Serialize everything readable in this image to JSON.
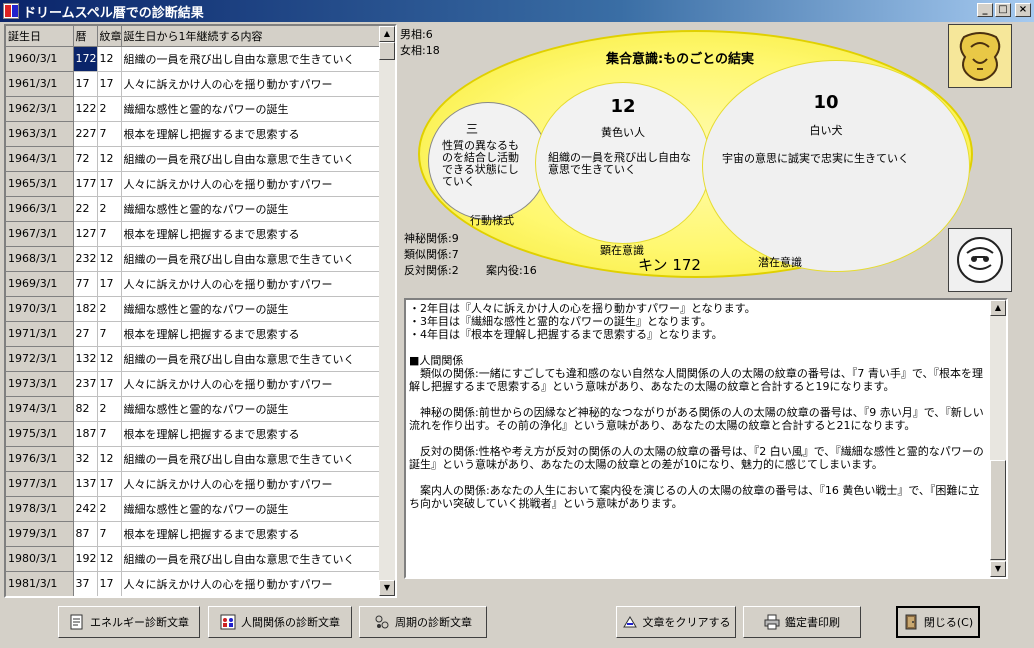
{
  "window": {
    "title": "ドリームスペル暦での診断結果",
    "min_glyph": "_",
    "max_glyph": "□",
    "close_glyph": "×"
  },
  "table": {
    "headers": [
      "誕生日",
      "暦",
      "紋章",
      "誕生日から1年継続する内容"
    ],
    "rows": [
      [
        "1960/3/1",
        "172",
        "12",
        "組織の一員を飛び出し自由な意思で生きていく"
      ],
      [
        "1961/3/1",
        "17",
        "17",
        "人々に訴えかけ人の心を揺り動かすパワー"
      ],
      [
        "1962/3/1",
        "122",
        "2",
        "繊細な感性と霊的なパワーの誕生"
      ],
      [
        "1963/3/1",
        "227",
        "7",
        "根本を理解し把握するまで思索する"
      ],
      [
        "1964/3/1",
        "72",
        "12",
        "組織の一員を飛び出し自由な意思で生きていく"
      ],
      [
        "1965/3/1",
        "177",
        "17",
        "人々に訴えかけ人の心を揺り動かすパワー"
      ],
      [
        "1966/3/1",
        "22",
        "2",
        "繊細な感性と霊的なパワーの誕生"
      ],
      [
        "1967/3/1",
        "127",
        "7",
        "根本を理解し把握するまで思索する"
      ],
      [
        "1968/3/1",
        "232",
        "12",
        "組織の一員を飛び出し自由な意思で生きていく"
      ],
      [
        "1969/3/1",
        "77",
        "17",
        "人々に訴えかけ人の心を揺り動かすパワー"
      ],
      [
        "1970/3/1",
        "182",
        "2",
        "繊細な感性と霊的なパワーの誕生"
      ],
      [
        "1971/3/1",
        "27",
        "7",
        "根本を理解し把握するまで思索する"
      ],
      [
        "1972/3/1",
        "132",
        "12",
        "組織の一員を飛び出し自由な意思で生きていく"
      ],
      [
        "1973/3/1",
        "237",
        "17",
        "人々に訴えかけ人の心を揺り動かすパワー"
      ],
      [
        "1974/3/1",
        "82",
        "2",
        "繊細な感性と霊的なパワーの誕生"
      ],
      [
        "1975/3/1",
        "187",
        "7",
        "根本を理解し把握するまで思索する"
      ],
      [
        "1976/3/1",
        "32",
        "12",
        "組織の一員を飛び出し自由な意思で生きていく"
      ],
      [
        "1977/3/1",
        "137",
        "17",
        "人々に訴えかけ人の心を揺り動かすパワー"
      ],
      [
        "1978/3/1",
        "242",
        "2",
        "繊細な感性と霊的なパワーの誕生"
      ],
      [
        "1979/3/1",
        "87",
        "7",
        "根本を理解し把握するまで思索する"
      ],
      [
        "1980/3/1",
        "192",
        "12",
        "組織の一員を飛び出し自由な意思で生きていく"
      ],
      [
        "1981/3/1",
        "37",
        "17",
        "人々に訴えかけ人の心を揺り動かすパワー"
      ]
    ]
  },
  "diagram": {
    "top_left_1": "男相:6",
    "top_left_2": "女相:18",
    "title": "集合意識:ものごとの結実",
    "circle1_label": "三",
    "circle1_desc": "性質の異なるものを結合し活動できる状態にしていく",
    "circle1_caption": "行動様式",
    "circle2_number": "12",
    "circle2_name": "黄色い人",
    "circle2_desc": "組織の一員を飛び出し自由な意思で生きていく",
    "circle2_caption": "顕在意識",
    "circle3_number": "10",
    "circle3_name": "白い犬",
    "circle3_desc": "宇宙の意思に誠実で忠実に生きていく",
    "circle3_caption": "潜在意識",
    "kin": "キン 172",
    "rel_shinpi": "神秘関係:9",
    "rel_ruiji": "類似関係:7",
    "rel_hantai": "反対関係:2",
    "rel_annai": "案内役:16"
  },
  "textarea": {
    "content": "・2年目は『人々に訴えかけ人の心を揺り動かすパワー』となります。\n・3年目は『繊細な感性と霊的なパワーの誕生』となります。\n・4年目は『根本を理解し把握するまで思索する』となります。\n\n■人間関係\n　類似の関係:一緒にすごしても違和感のない自然な人間関係の人の太陽の紋章の番号は、『7 青い手』で、『根本を理解し把握するまで思索する』という意味があり、あなたの太陽の紋章と合計すると19になります。\n\n　神秘の関係:前世からの因縁など神秘的なつながりがある関係の人の太陽の紋章の番号は、『9 赤い月』で、『新しい流れを作り出す。その前の浄化』という意味があり、あなたの太陽の紋章と合計すると21になります。\n\n　反対の関係:性格や考え方が反対の関係の人の太陽の紋章の番号は、『2 白い風』で、『繊細な感性と霊的なパワーの誕生』という意味があり、あなたの太陽の紋章との差が10になり、魅力的に感じてしまいます。\n\n　案内人の関係:あなたの人生において案内役を演じるの人の太陽の紋章の番号は、『16 黄色い戦士』で、『困難に立ち向かい突破していく挑戦者』という意味があります。"
  },
  "buttons": {
    "energy": "エネルギー診断文章",
    "relations": "人間関係の診断文章",
    "cycle": "周期の診断文章",
    "clear": "文章をクリアする",
    "print": "鑑定書印刷",
    "close": "閉じる(C)"
  },
  "colors": {
    "selection": "#0a246a",
    "ellipse": "#fff870"
  }
}
